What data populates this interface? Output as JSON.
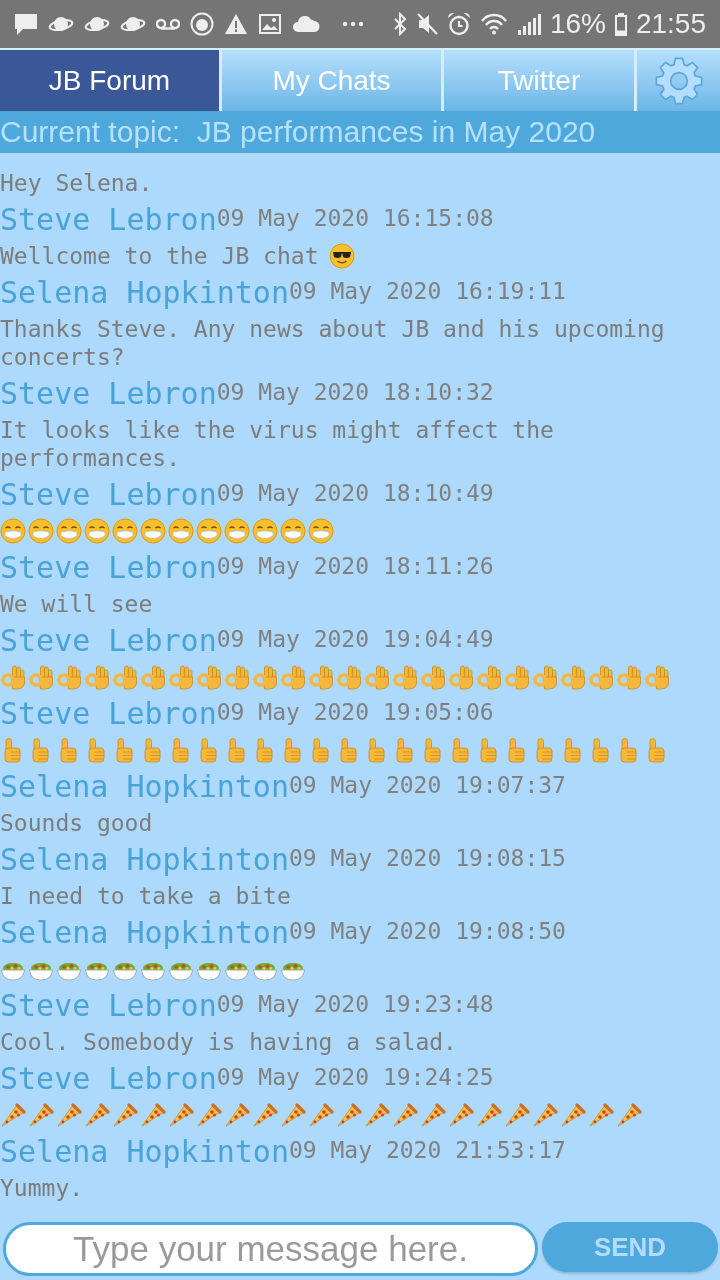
{
  "status_bar": {
    "battery": "16%",
    "time": "21:55"
  },
  "tabs": [
    {
      "label": "JB Forum",
      "selected": true
    },
    {
      "label": "My Chats",
      "selected": false
    },
    {
      "label": "Twitter",
      "selected": false
    }
  ],
  "topic": "Current topic:  JB performances in May 2020",
  "messages": [
    {
      "text": "Hey Selena."
    },
    {
      "sender": "Steve Lebron",
      "time": "09 May 2020 16:15:08",
      "text": "Wellcome to the JB chat",
      "emojis": [
        {
          "kind": "sunglasses"
        }
      ]
    },
    {
      "sender": "Selena Hopkinton",
      "time": "09 May 2020 16:19:11",
      "text": "Thanks Steve. Any news about JB and his upcoming concerts?"
    },
    {
      "sender": "Steve Lebron",
      "time": "09 May 2020 18:10:32",
      "text": "It looks like the virus might affect the performances."
    },
    {
      "sender": "Steve Lebron",
      "time": "09 May 2020 18:10:49",
      "emojis": [
        {
          "kind": "mask"
        },
        {
          "kind": "mask"
        },
        {
          "kind": "mask"
        },
        {
          "kind": "mask"
        },
        {
          "kind": "mask"
        },
        {
          "kind": "mask"
        },
        {
          "kind": "mask"
        },
        {
          "kind": "mask"
        },
        {
          "kind": "mask"
        },
        {
          "kind": "mask"
        },
        {
          "kind": "mask"
        },
        {
          "kind": "mask"
        }
      ]
    },
    {
      "sender": "Steve Lebron",
      "time": "09 May 2020 18:11:26",
      "text": "We will see"
    },
    {
      "sender": "Steve Lebron",
      "time": "09 May 2020 19:04:49",
      "emojis": [
        {
          "kind": "ok"
        },
        {
          "kind": "ok"
        },
        {
          "kind": "ok"
        },
        {
          "kind": "ok"
        },
        {
          "kind": "ok"
        },
        {
          "kind": "ok"
        },
        {
          "kind": "ok"
        },
        {
          "kind": "ok"
        },
        {
          "kind": "ok"
        },
        {
          "kind": "ok"
        },
        {
          "kind": "ok"
        },
        {
          "kind": "ok"
        },
        {
          "kind": "ok"
        },
        {
          "kind": "ok"
        },
        {
          "kind": "ok"
        },
        {
          "kind": "ok"
        },
        {
          "kind": "ok"
        },
        {
          "kind": "ok"
        },
        {
          "kind": "ok"
        },
        {
          "kind": "ok"
        },
        {
          "kind": "ok"
        },
        {
          "kind": "ok"
        },
        {
          "kind": "ok"
        },
        {
          "kind": "ok"
        }
      ]
    },
    {
      "sender": "Steve Lebron",
      "time": "09 May 2020 19:05:06",
      "emojis": [
        {
          "kind": "thumbs"
        },
        {
          "kind": "thumbs"
        },
        {
          "kind": "thumbs"
        },
        {
          "kind": "thumbs"
        },
        {
          "kind": "thumbs"
        },
        {
          "kind": "thumbs"
        },
        {
          "kind": "thumbs"
        },
        {
          "kind": "thumbs"
        },
        {
          "kind": "thumbs"
        },
        {
          "kind": "thumbs"
        },
        {
          "kind": "thumbs"
        },
        {
          "kind": "thumbs"
        },
        {
          "kind": "thumbs"
        },
        {
          "kind": "thumbs"
        },
        {
          "kind": "thumbs"
        },
        {
          "kind": "thumbs"
        },
        {
          "kind": "thumbs"
        },
        {
          "kind": "thumbs"
        },
        {
          "kind": "thumbs"
        },
        {
          "kind": "thumbs"
        },
        {
          "kind": "thumbs"
        },
        {
          "kind": "thumbs"
        },
        {
          "kind": "thumbs"
        },
        {
          "kind": "thumbs"
        }
      ]
    },
    {
      "sender": "Selena Hopkinton",
      "time": "09 May 2020 19:07:37",
      "text": "Sounds good"
    },
    {
      "sender": "Selena Hopkinton",
      "time": "09 May 2020 19:08:15",
      "text": "I need to take a bite"
    },
    {
      "sender": "Selena Hopkinton",
      "time": "09 May 2020 19:08:50",
      "emojis": [
        {
          "kind": "salad"
        },
        {
          "kind": "salad"
        },
        {
          "kind": "salad"
        },
        {
          "kind": "salad"
        },
        {
          "kind": "salad"
        },
        {
          "kind": "salad"
        },
        {
          "kind": "salad"
        },
        {
          "kind": "salad"
        },
        {
          "kind": "salad"
        },
        {
          "kind": "salad"
        },
        {
          "kind": "salad"
        }
      ]
    },
    {
      "sender": "Steve Lebron",
      "time": "09 May 2020 19:23:48",
      "text": "Cool. Somebody is having a salad."
    },
    {
      "sender": "Steve Lebron",
      "time": "09 May 2020 19:24:25",
      "emojis": [
        {
          "kind": "pizza"
        },
        {
          "kind": "pizza"
        },
        {
          "kind": "pizza"
        },
        {
          "kind": "pizza"
        },
        {
          "kind": "pizza"
        },
        {
          "kind": "pizza"
        },
        {
          "kind": "pizza"
        },
        {
          "kind": "pizza"
        },
        {
          "kind": "pizza"
        },
        {
          "kind": "pizza"
        },
        {
          "kind": "pizza"
        },
        {
          "kind": "pizza"
        },
        {
          "kind": "pizza"
        },
        {
          "kind": "pizza"
        },
        {
          "kind": "pizza"
        },
        {
          "kind": "pizza"
        },
        {
          "kind": "pizza"
        },
        {
          "kind": "pizza"
        },
        {
          "kind": "pizza"
        },
        {
          "kind": "pizza"
        },
        {
          "kind": "pizza"
        },
        {
          "kind": "pizza"
        },
        {
          "kind": "pizza"
        }
      ]
    },
    {
      "sender": "Selena Hopkinton",
      "time": "09 May 2020 21:53:17",
      "text": "Yummy."
    }
  ],
  "composer": {
    "placeholder": "Type your message here.",
    "send_label": "SEND"
  }
}
